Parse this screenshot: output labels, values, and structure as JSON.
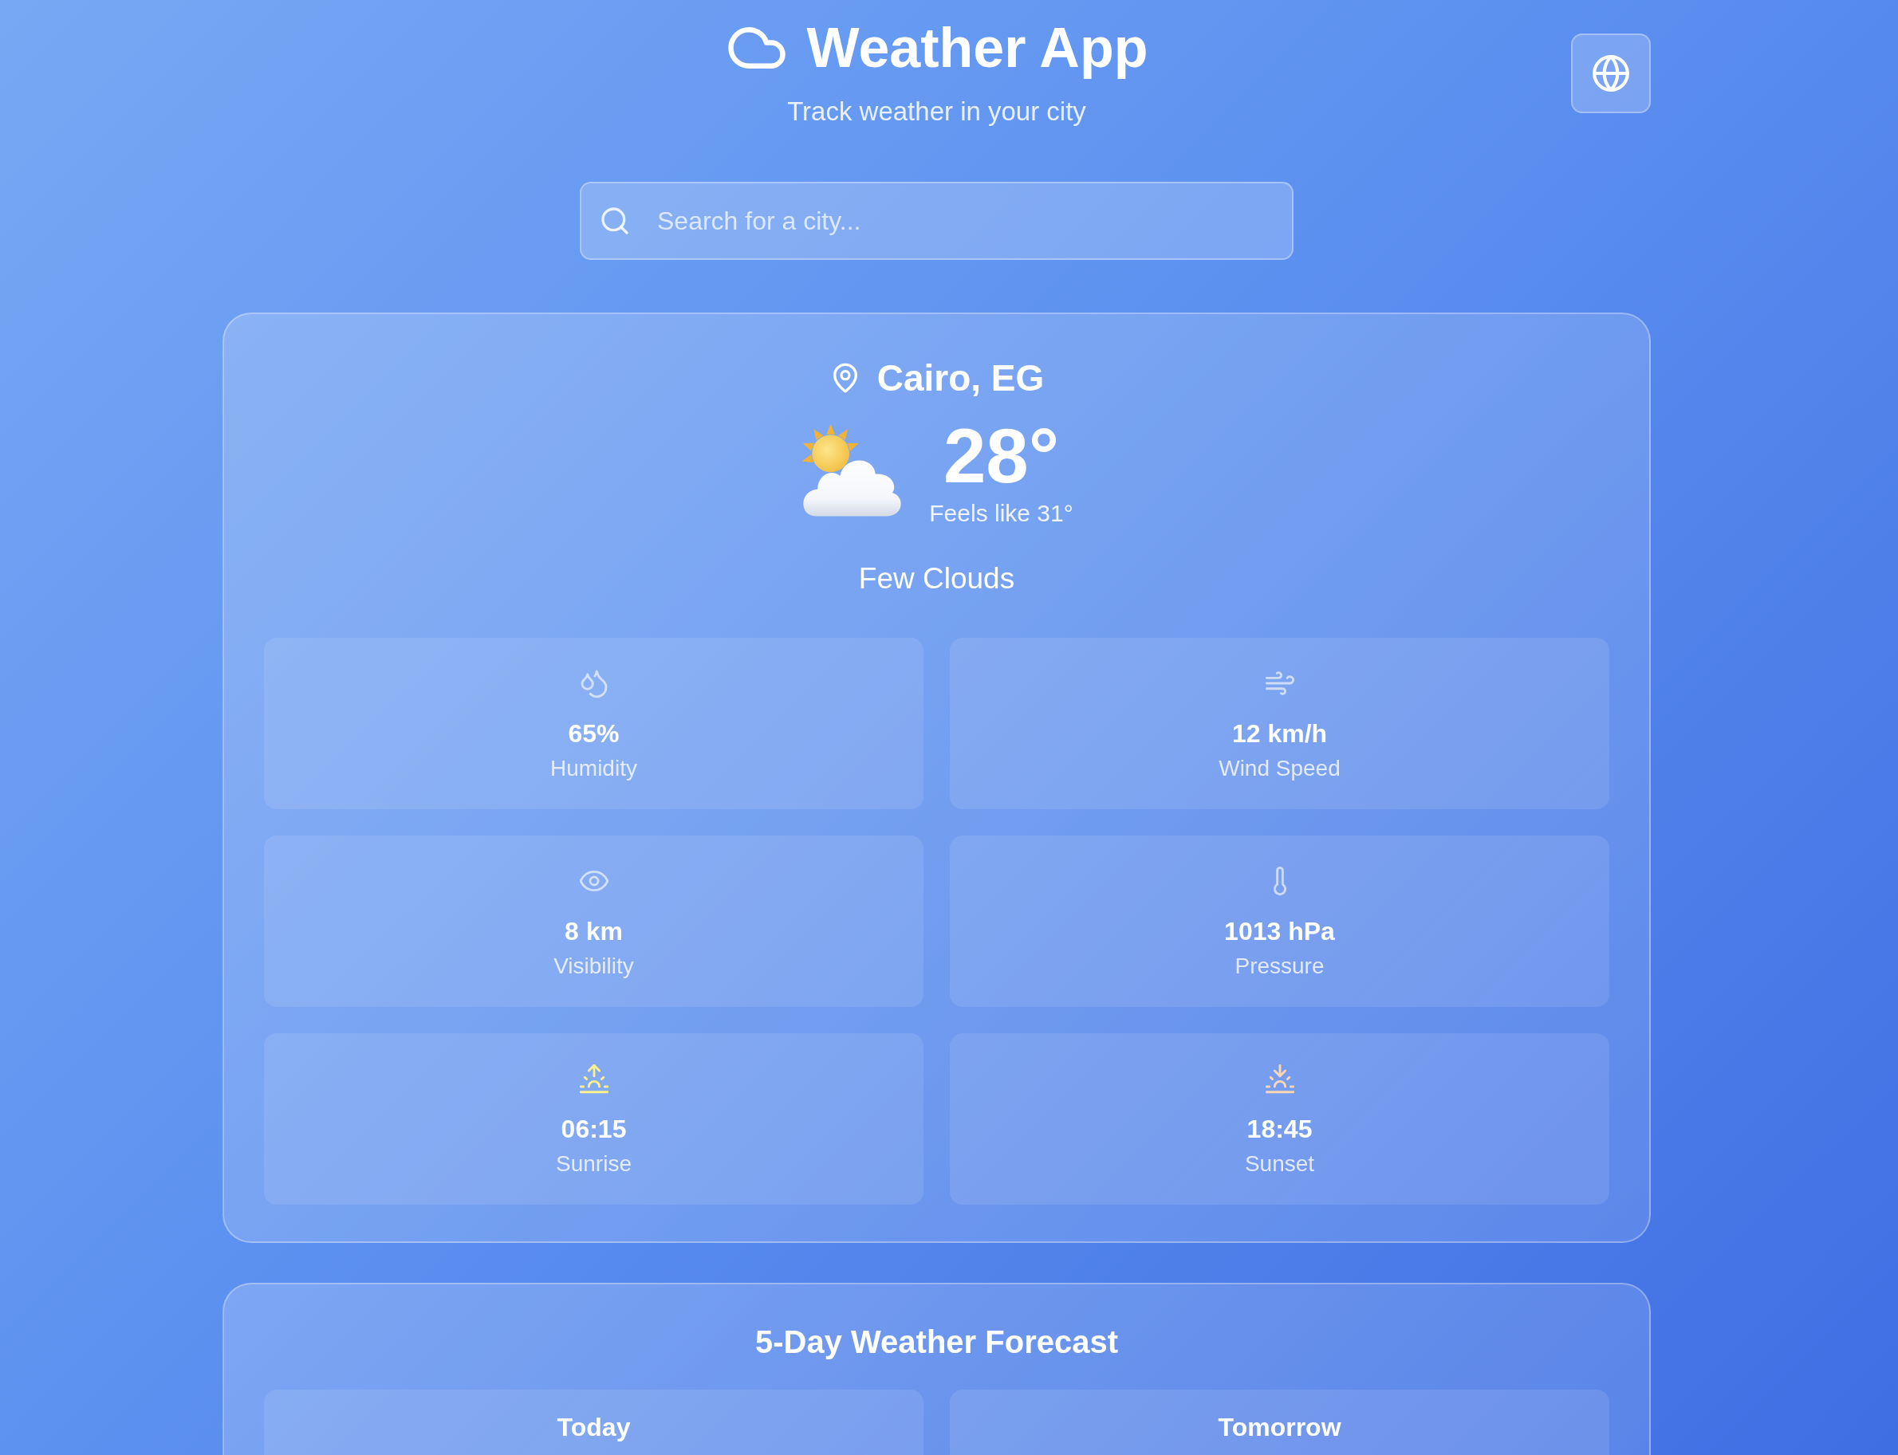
{
  "header": {
    "title": "Weather App",
    "subtitle": "Track weather in your city"
  },
  "search": {
    "placeholder": "Search for a city..."
  },
  "current": {
    "location": "Cairo, EG",
    "temperature": "28°",
    "feels_like": "Feels like 31°",
    "condition": "Few Clouds",
    "stats": [
      {
        "kind": "humidity",
        "value": "65%",
        "label": "Humidity"
      },
      {
        "kind": "wind",
        "value": "12 km/h",
        "label": "Wind Speed"
      },
      {
        "kind": "visibility",
        "value": "8 km",
        "label": "Visibility"
      },
      {
        "kind": "pressure",
        "value": "1013 hPa",
        "label": "Pressure"
      },
      {
        "kind": "sunrise",
        "value": "06:15",
        "label": "Sunrise"
      },
      {
        "kind": "sunset",
        "value": "18:45",
        "label": "Sunset"
      }
    ]
  },
  "forecast": {
    "title": "5-Day Weather Forecast",
    "days": [
      {
        "label": "Today"
      },
      {
        "label": "Tomorrow"
      }
    ]
  }
}
